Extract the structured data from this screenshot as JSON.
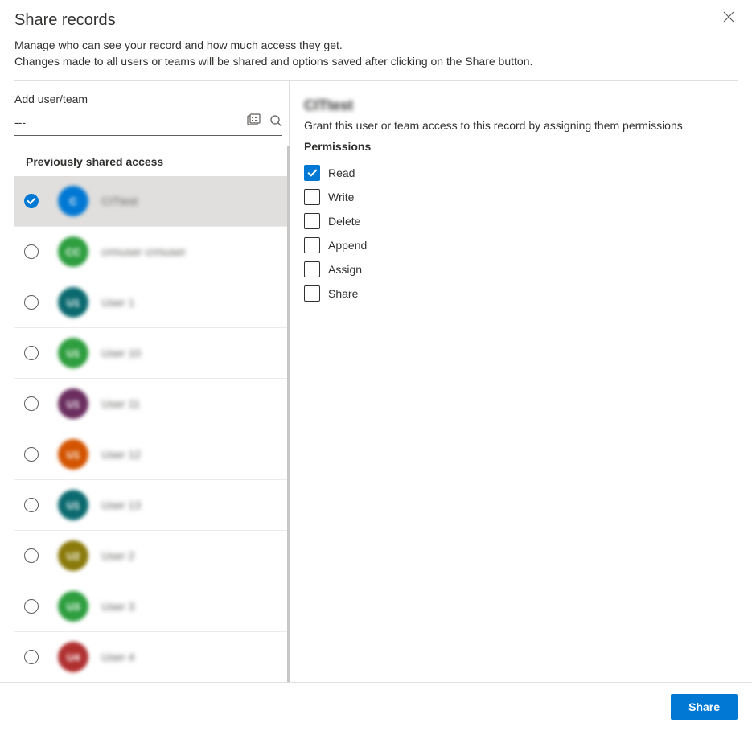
{
  "header": {
    "title": "Share records",
    "subtitle_line1": "Manage who can see your record and how much access they get.",
    "subtitle_line2": "Changes made to all users or teams will be shared and options saved after clicking on the Share button."
  },
  "left": {
    "add_label": "Add user/team",
    "search_value": "---",
    "section_header": "Previously shared access",
    "items": [
      {
        "name": "CITtest",
        "initials": "C",
        "color": "#0078d4",
        "selected": true
      },
      {
        "name": "crmuser crmuser",
        "initials": "CC",
        "color": "#2e9e3f",
        "selected": false
      },
      {
        "name": "User 1",
        "initials": "U1",
        "color": "#0b6a6f",
        "selected": false
      },
      {
        "name": "User 10",
        "initials": "U1",
        "color": "#2e9e3f",
        "selected": false
      },
      {
        "name": "User 11",
        "initials": "U1",
        "color": "#6b2e5f",
        "selected": false
      },
      {
        "name": "User 12",
        "initials": "U1",
        "color": "#d35400",
        "selected": false
      },
      {
        "name": "User 13",
        "initials": "U1",
        "color": "#0b6a6f",
        "selected": false
      },
      {
        "name": "User 2",
        "initials": "U2",
        "color": "#8a7a0b",
        "selected": false
      },
      {
        "name": "User 3",
        "initials": "U3",
        "color": "#2e9e3f",
        "selected": false
      },
      {
        "name": "User 4",
        "initials": "U4",
        "color": "#b03030",
        "selected": false
      }
    ]
  },
  "right": {
    "selected_name": "CITtest",
    "grant_text": "Grant this user or team access to this record by assigning them permissions",
    "permissions_header": "Permissions",
    "permissions": [
      {
        "label": "Read",
        "checked": true
      },
      {
        "label": "Write",
        "checked": false
      },
      {
        "label": "Delete",
        "checked": false
      },
      {
        "label": "Append",
        "checked": false
      },
      {
        "label": "Assign",
        "checked": false
      },
      {
        "label": "Share",
        "checked": false
      }
    ]
  },
  "footer": {
    "share_label": "Share"
  }
}
